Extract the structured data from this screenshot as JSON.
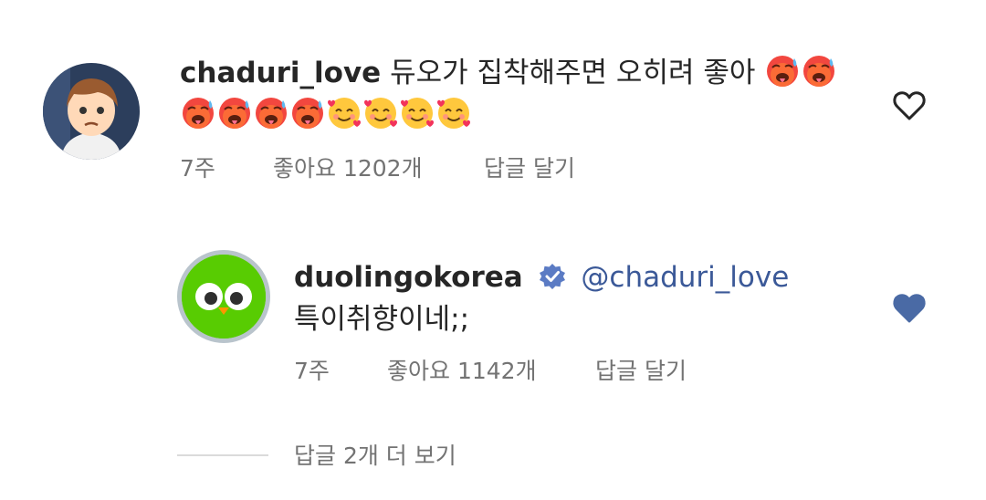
{
  "comment": {
    "username": "chaduri_love",
    "text": "듀오가 집착해주면 오히려 좋아",
    "emojis_line1": [
      "hot-face-emoji",
      "hot-face-emoji"
    ],
    "emojis_line2": [
      "hot-face-emoji",
      "hot-face-emoji",
      "hot-face-emoji",
      "hot-face-emoji",
      "smiling-face-with-hearts-emoji",
      "smiling-face-with-hearts-emoji",
      "smiling-face-with-hearts-emoji",
      "smiling-face-with-hearts-emoji"
    ],
    "time": "7주",
    "likes": "좋아요 1202개",
    "reply_action": "답글 달기",
    "liked": false
  },
  "reply": {
    "username": "duolingokorea",
    "verified": true,
    "mention": "@chaduri_love",
    "text": "특이취향이네;;",
    "time": "7주",
    "likes": "좋아요 1142개",
    "reply_action": "답글 달기",
    "liked": true
  },
  "more_replies": "답글 2개 더 보기",
  "colors": {
    "liked_heart": "#4a6aa5",
    "meta_text": "#737373",
    "mention": "#3b5998",
    "verified_badge": "#5b7bc4"
  }
}
